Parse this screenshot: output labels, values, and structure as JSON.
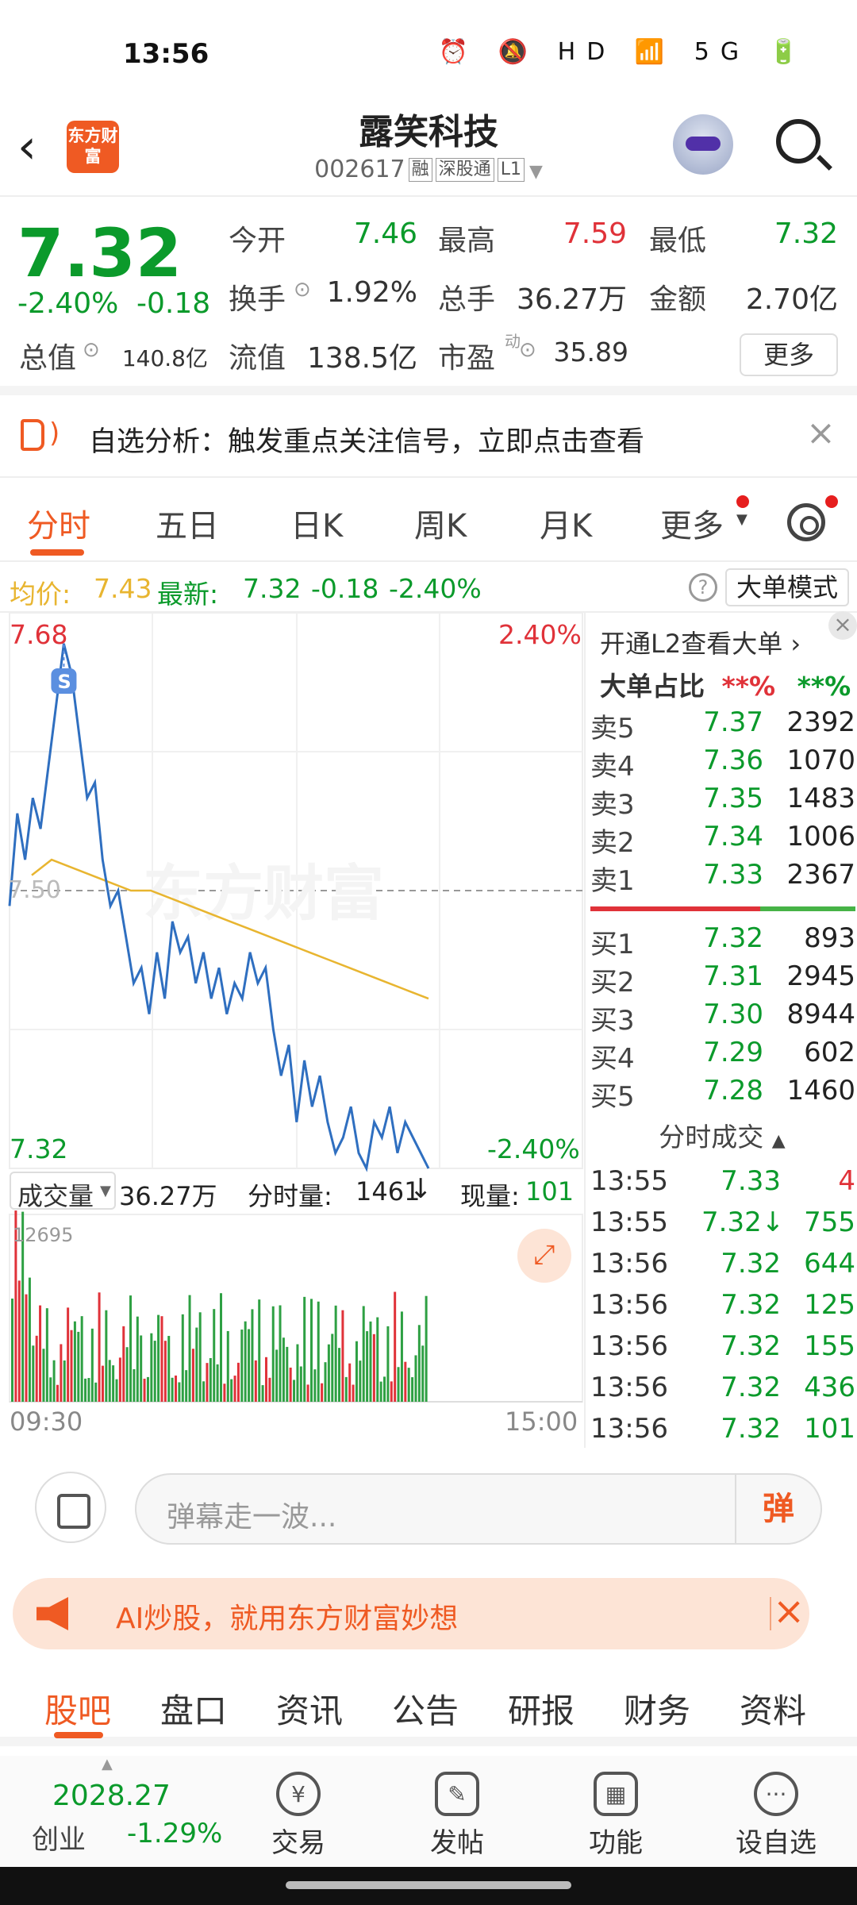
{
  "status": {
    "time": "13:56",
    "icons": "⏰ 🔕 HD 📶 5G 🔋"
  },
  "header": {
    "logo": "东方财富",
    "name": "露笑科技",
    "code": "002617",
    "tags": [
      "融",
      "深股通",
      "L1"
    ]
  },
  "quote": {
    "price": "7.32",
    "change_pct": "-2.40%",
    "change": "-0.18",
    "open_label": "今开",
    "open": "7.46",
    "high_label": "最高",
    "high": "7.59",
    "low_label": "最低",
    "low": "7.32",
    "turnover_label": "换手",
    "turnover": "1.92%",
    "volume_label": "总手",
    "volume": "36.27万",
    "amount_label": "金额",
    "amount": "2.70亿",
    "mktcap_label": "总值",
    "mktcap": "140.8亿",
    "float_label": "流值",
    "float": "138.5亿",
    "pe_label": "市盈",
    "pe_sup": "动",
    "pe": "35.89",
    "more": "更多"
  },
  "alert": {
    "text": "自选分析：触发重点关注信号，立即点击查看"
  },
  "tabs": [
    "分时",
    "五日",
    "日K",
    "周K",
    "月K",
    "更多"
  ],
  "avgbar": {
    "avg_label": "均价:",
    "avg": "7.43",
    "latest_label": "最新:",
    "latest": "7.32",
    "chg": "-0.18",
    "pct": "-2.40%",
    "help": "?",
    "mode": "大单模式"
  },
  "chart_data": {
    "type": "line",
    "y_top_label": "7.68",
    "y_bottom_label": "7.32",
    "y_mid_label": "7.50",
    "pct_top": "2.40%",
    "pct_bottom": "-2.40%",
    "ylim": [
      7.32,
      7.68
    ],
    "x_start": "09:30",
    "x_end": "15:00",
    "marker": "S",
    "series": [
      {
        "values": [
          7.49,
          7.55,
          7.52,
          7.56,
          7.54,
          7.58,
          7.62,
          7.66,
          7.64,
          7.6,
          7.56,
          7.57,
          7.52,
          7.49,
          7.5,
          7.47,
          7.44,
          7.45,
          7.42,
          7.46,
          7.43,
          7.48,
          7.46,
          7.47,
          7.44,
          7.46,
          7.43,
          7.45,
          7.42,
          7.44,
          7.43,
          7.46,
          7.44,
          7.45,
          7.41,
          7.38,
          7.4,
          7.35,
          7.39,
          7.36,
          7.38,
          7.35,
          7.33,
          7.34,
          7.36,
          7.33,
          7.32,
          7.35,
          7.34,
          7.36,
          7.33,
          7.35,
          7.34,
          7.33,
          7.32
        ]
      },
      {
        "values": [
          7.51,
          7.52,
          7.515,
          7.51,
          7.505,
          7.5,
          7.5,
          7.495,
          7.49,
          7.485,
          7.48,
          7.475,
          7.47,
          7.465,
          7.46,
          7.455,
          7.45,
          7.445,
          7.44,
          7.435,
          7.43
        ]
      }
    ],
    "volume_label": "成交量",
    "volume_total": "36.27万",
    "tick_vol_label": "分时量:",
    "tick_vol": "1461",
    "now_vol_label": "现量:",
    "now_vol": "101",
    "volume_max": "12695"
  },
  "book": {
    "head": "开通L2查看大单",
    "ratio_label": "大单占比",
    "ratio_red": "**%",
    "ratio_green": "**%",
    "asks": [
      {
        "label": "卖5",
        "price": "7.37",
        "vol": "2392"
      },
      {
        "label": "卖4",
        "price": "7.36",
        "vol": "1070"
      },
      {
        "label": "卖3",
        "price": "7.35",
        "vol": "1483"
      },
      {
        "label": "卖2",
        "price": "7.34",
        "vol": "1006"
      },
      {
        "label": "卖1",
        "price": "7.33",
        "vol": "2367"
      }
    ],
    "bids": [
      {
        "label": "买1",
        "price": "7.32",
        "vol": "893"
      },
      {
        "label": "买2",
        "price": "7.31",
        "vol": "2945"
      },
      {
        "label": "买3",
        "price": "7.30",
        "vol": "8944"
      },
      {
        "label": "买4",
        "price": "7.29",
        "vol": "602"
      },
      {
        "label": "买5",
        "price": "7.28",
        "vol": "1460"
      }
    ],
    "trades_title": "分时成交",
    "trades": [
      {
        "time": "13:55",
        "price": "7.33",
        "vol": "4"
      },
      {
        "time": "13:55",
        "price": "7.32↓",
        "vol": "755"
      },
      {
        "time": "13:56",
        "price": "7.32",
        "vol": "644"
      },
      {
        "time": "13:56",
        "price": "7.32",
        "vol": "125"
      },
      {
        "time": "13:56",
        "price": "7.32",
        "vol": "155"
      },
      {
        "time": "13:56",
        "price": "7.32",
        "vol": "436"
      },
      {
        "time": "13:56",
        "price": "7.32",
        "vol": "101"
      }
    ]
  },
  "danmu": {
    "placeholder": "弹幕走一波...",
    "button": "弹"
  },
  "ai": {
    "text": "AI炒股，就用东方财富妙想"
  },
  "bottom_tabs": [
    "股吧",
    "盘口",
    "资讯",
    "公告",
    "研报",
    "财务",
    "资料"
  ],
  "nav": {
    "index_value": "2028.27",
    "index_name": "创业",
    "index_change": "-1.29%",
    "items": [
      "交易",
      "发帖",
      "功能",
      "设自选"
    ]
  },
  "colors": {
    "accent": "#ef5a23",
    "up": "#e03239",
    "down": "#0b9a2b",
    "avg_line": "#e8b530",
    "price_line": "#2f6fc0"
  }
}
